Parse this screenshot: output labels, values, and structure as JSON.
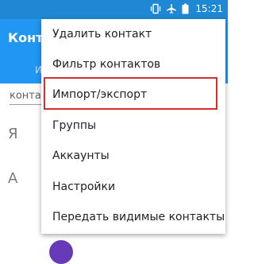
{
  "status_bar": {
    "time": "15:21",
    "icons": [
      "vibrate-icon",
      "airplane-icon",
      "battery-icon"
    ]
  },
  "app_bar": {
    "title": "Конта",
    "tab_label": "И"
  },
  "content": {
    "search_field_text": "конта",
    "section_letters": [
      "Я",
      "А"
    ]
  },
  "menu": {
    "items": [
      {
        "label": "Удалить контакт"
      },
      {
        "label": "Фильтр контактов"
      },
      {
        "label": "Импорт/экспорт",
        "highlighted": true
      },
      {
        "label": "Группы"
      },
      {
        "label": "Аккаунты"
      },
      {
        "label": "Настройки"
      },
      {
        "label": "Передать видимые контакты"
      }
    ]
  },
  "colors": {
    "status_bar": "#1e88d4",
    "app_bar": "#2196f3",
    "highlight_border": "#d32f2f",
    "avatar": "#673ab7"
  }
}
